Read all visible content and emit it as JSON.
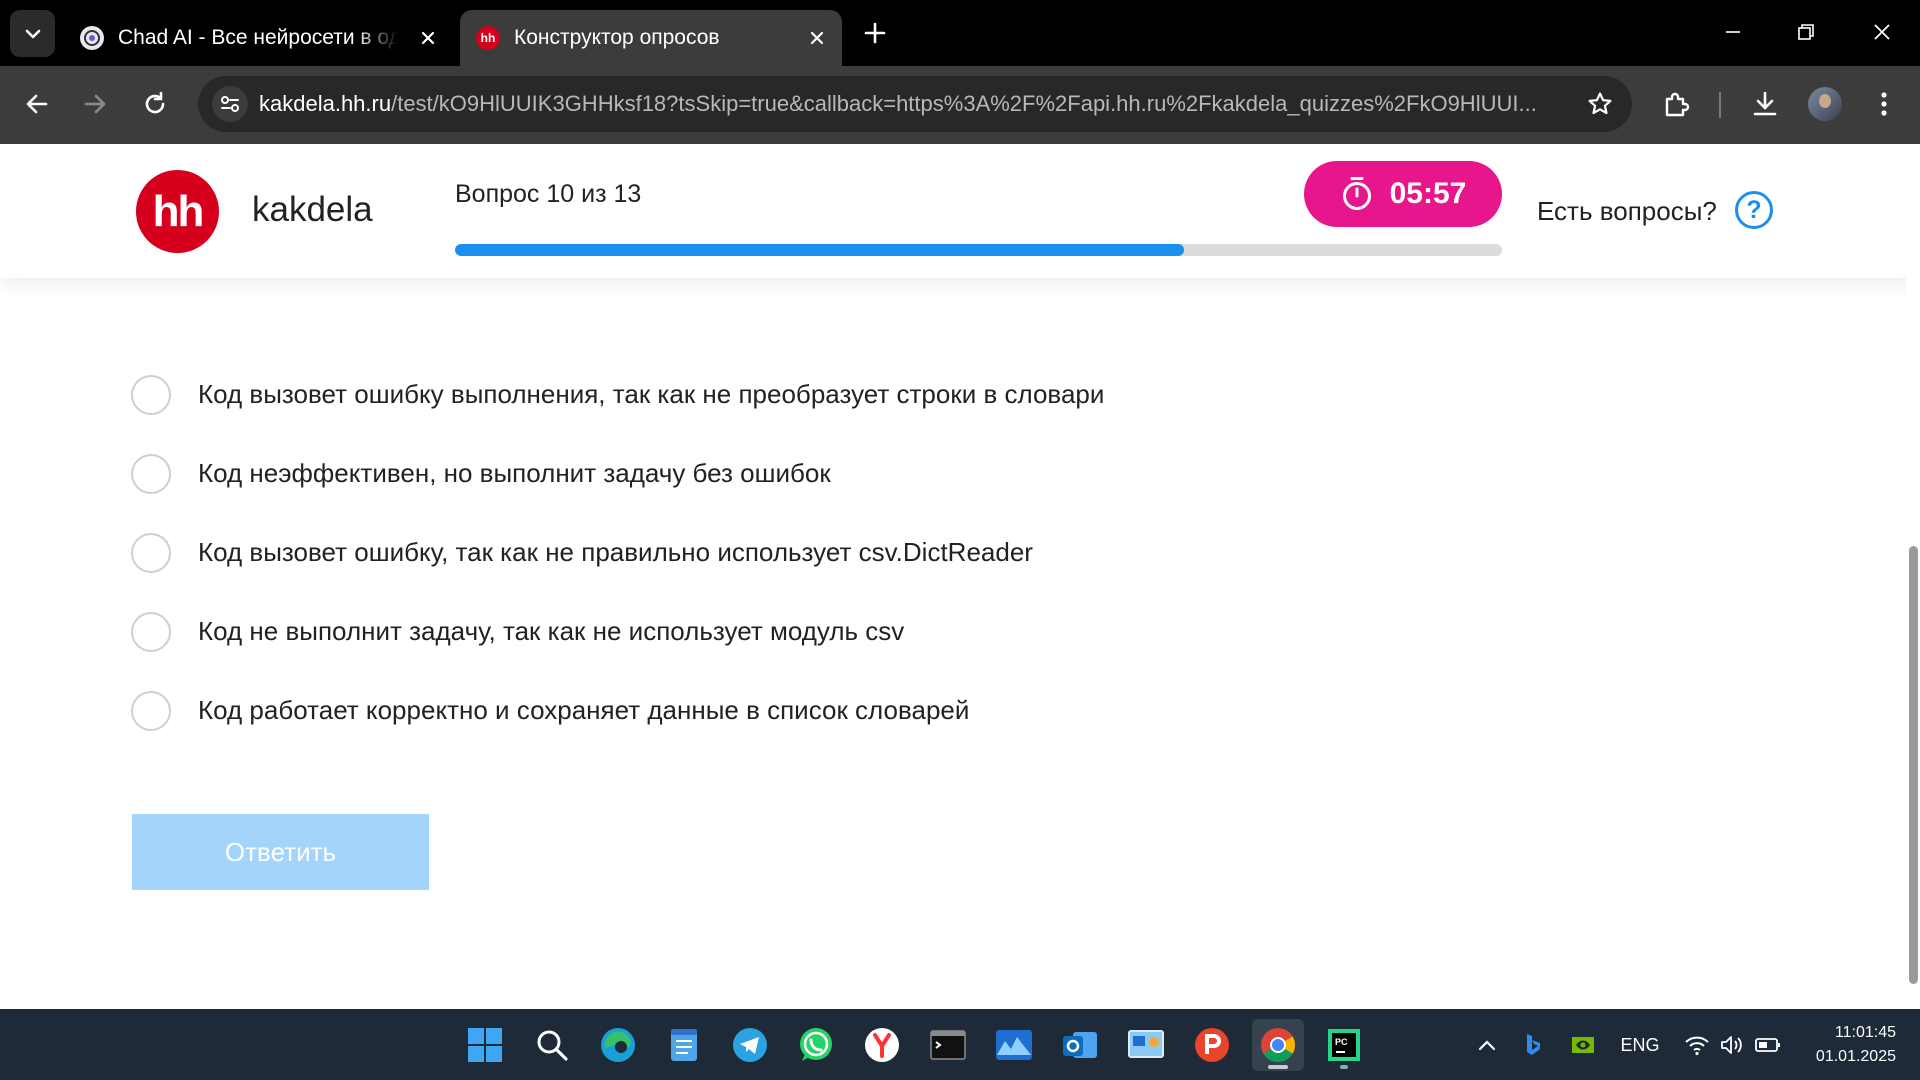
{
  "browser": {
    "tabs": [
      {
        "title": "Chad AI - Все нейросети в одном",
        "favicon": "chad-ai-icon",
        "active": false
      },
      {
        "title": "Конструктор опросов",
        "favicon": "hh-icon",
        "favicon_text": "hh",
        "active": true
      }
    ],
    "address": {
      "host": "kakdela.hh.ru",
      "path": "/test/kO9HlUUIK3GHHksf18?tsSkip=true&callback=https%3A%2F%2Fapi.hh.ru%2Fkakdela_quizzes%2FkO9HlUUI..."
    }
  },
  "header": {
    "logo_text": "hh",
    "brand": "kakdela",
    "question_counter": "Вопрос 10 из 13",
    "progress_fraction": 0.696,
    "timer": "05:57",
    "help_text": "Есть вопросы?",
    "help_icon_text": "?"
  },
  "options": [
    "Код вызовет ошибку выполнения, так как не преобразует строки в словари",
    "Код неэффективен, но выполнит задачу без ошибок",
    "Код вызовет ошибку, так как не правильно использует csv.DictReader",
    "Код не выполнит задачу, так как не использует модуль csv",
    "Код работает корректно и сохраняет данные в список словарей"
  ],
  "submit_label": "Ответить",
  "taskbar": {
    "apps": [
      "start",
      "search",
      "edge",
      "notepad",
      "telegram",
      "whatsapp",
      "yandex-browser",
      "terminal",
      "photos",
      "outlook",
      "control-panel",
      "pycharm-edu",
      "chrome",
      "pycharm"
    ],
    "tray_language": "ENG",
    "time": "11:01:45",
    "date": "01.01.2025"
  },
  "colors": {
    "brand_red": "#d6001c",
    "timer_pink": "#e7168c",
    "accent_blue": "#1a8ff0",
    "submit_disabled": "#a3d4fb"
  }
}
